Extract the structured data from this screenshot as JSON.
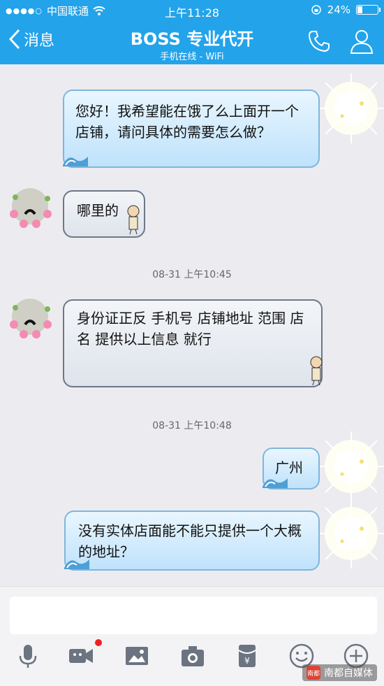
{
  "status_bar": {
    "carrier": "中国联通",
    "time": "上午11:28",
    "battery": "24%"
  },
  "nav": {
    "back_label": "消息",
    "title": "BOSS  专业代开",
    "subtitle": "手机在线 - WiFi"
  },
  "messages": [
    {
      "dir": "out",
      "text": "您好！我希望能在饿了么上面开一个店铺，请问具体的需要怎么做？"
    },
    {
      "dir": "in",
      "text": "哪里的"
    },
    {
      "dir": "in",
      "text": "身份证正反  手机号   店铺地址  范围  店名      提供以上信息  就行"
    },
    {
      "dir": "out",
      "text": "广州"
    },
    {
      "dir": "out",
      "text": "没有实体店面能不能只提供一个大概的地址？"
    }
  ],
  "timestamps": [
    "08-31 上午10:45",
    "08-31 上午10:48"
  ],
  "input": {
    "placeholder": ""
  },
  "toolbar": [
    "microphone-icon",
    "video-call-icon",
    "image-icon",
    "camera-icon",
    "red-packet-icon",
    "emoji-icon",
    "plus-icon"
  ],
  "watermark": {
    "logo": "南都",
    "text": "南都自媒体"
  },
  "colors": {
    "nav_bg": "#23a3ea",
    "chat_bg": "#ececf0",
    "badge": "#e22222"
  }
}
